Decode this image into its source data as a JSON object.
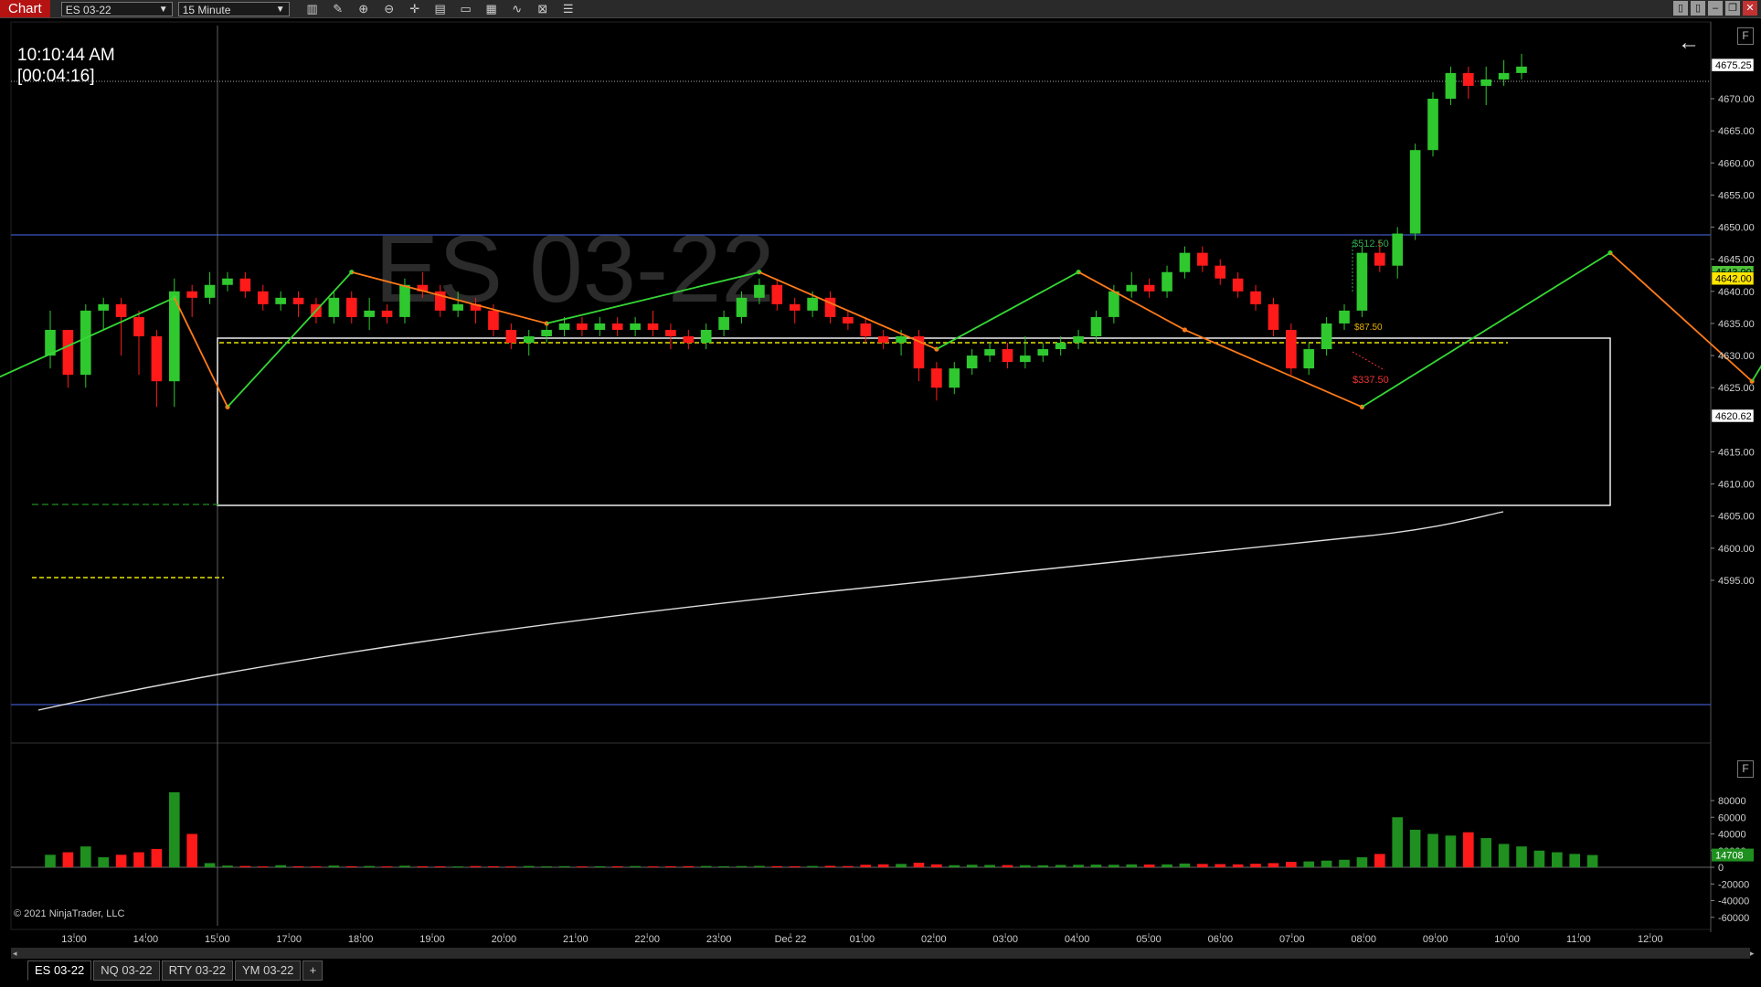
{
  "toolbar": {
    "window_label": "Chart",
    "instrument": "ES 03-22",
    "period": "15 Minute",
    "tools": [
      "bar-type-icon",
      "draw-icon",
      "zoom-in-icon",
      "zoom-out-icon",
      "crosshair-icon",
      "properties-icon",
      "templates-icon",
      "chart-trader-icon",
      "indicators-icon",
      "strategies-icon",
      "data-box-icon"
    ]
  },
  "clock": {
    "time": "10:10:44 AM",
    "bar_timer": "[00:04:16]"
  },
  "watermark": "ES 03-22",
  "price_axis": {
    "labels": [
      "4670.00",
      "4665.00",
      "4660.00",
      "4655.00",
      "4650.00",
      "4645.00",
      "4640.00",
      "4635.00",
      "4630.00",
      "4625.00",
      "4615.00",
      "4610.00",
      "4605.00",
      "4600.00",
      "4595.00"
    ],
    "markers": [
      {
        "label": "4675.25",
        "bg": "#ffffff",
        "fg": "#000000"
      },
      {
        "label": "4643.00",
        "bg": "#4fc13a",
        "fg": "#000000"
      },
      {
        "label": "4642.00",
        "bg": "#ffe500",
        "fg": "#000000"
      },
      {
        "label": "4620.62",
        "bg": "#ffffff",
        "fg": "#000000"
      }
    ]
  },
  "volume_axis": {
    "labels": [
      "80000",
      "60000",
      "40000",
      "20000",
      "0",
      "-20000",
      "-40000",
      "-60000"
    ],
    "marker": {
      "label": "14708",
      "bg": "#1f8f1f",
      "fg": "#ffffff"
    }
  },
  "time_axis": {
    "labels": [
      "13:00",
      "14:00",
      "15:00",
      "17:00",
      "18:00",
      "19:00",
      "20:00",
      "21:00",
      "22:00",
      "23:00",
      "Dec 22",
      "01:00",
      "02:00",
      "03:00",
      "04:00",
      "05:00",
      "06:00",
      "07:00",
      "08:00",
      "09:00",
      "10:00",
      "11:00",
      "12:00"
    ]
  },
  "trade_labels": {
    "profit": "$512.50",
    "target": "$87.50",
    "loss": "$337.50"
  },
  "copyright": "© 2021 NinjaTrader, LLC",
  "f_button": "F",
  "tabs": [
    {
      "label": "ES 03-22"
    },
    {
      "label": "NQ 03-22"
    },
    {
      "label": "RTY 03-22"
    },
    {
      "label": "YM 03-22"
    }
  ],
  "tab_add": "+",
  "colors": {
    "up": "#2fc82f",
    "down": "#ff1a1a",
    "zigzag_up": "#35d835",
    "zigzag_down": "#ff7a18",
    "range_box": "#ffffff",
    "hline": "#3d57c4",
    "dashed_yellow": "#e8e200",
    "vol_up": "#1f8f1f",
    "vol_down": "#ff1a1a"
  },
  "candles": [
    [
      4630,
      4637,
      4628,
      4634
    ],
    [
      4634,
      4633,
      4625,
      4627
    ],
    [
      4627,
      4638,
      4625,
      4637
    ],
    [
      4637,
      4639,
      4634,
      4638
    ],
    [
      4638,
      4639,
      4630,
      4636
    ],
    [
      4636,
      4637,
      4627,
      4633
    ],
    [
      4633,
      4634,
      4622,
      4626
    ],
    [
      4626,
      4642,
      4622,
      4640
    ],
    [
      4640,
      4641,
      4636,
      4639
    ],
    [
      4639,
      4643,
      4638,
      4641
    ],
    [
      4641,
      4643,
      4640,
      4642
    ],
    [
      4642,
      4643,
      4639,
      4640
    ],
    [
      4640,
      4641,
      4637,
      4638
    ],
    [
      4638,
      4640,
      4637,
      4639
    ],
    [
      4639,
      4640,
      4636,
      4638
    ],
    [
      4638,
      4639,
      4635,
      4636
    ],
    [
      4636,
      4640,
      4635,
      4639
    ],
    [
      4639,
      4640,
      4635,
      4636
    ],
    [
      4636,
      4639,
      4634,
      4637
    ],
    [
      4637,
      4638,
      4635,
      4636
    ],
    [
      4636,
      4642,
      4635,
      4641
    ],
    [
      4641,
      4643,
      4639,
      4640
    ],
    [
      4640,
      4641,
      4636,
      4637
    ],
    [
      4637,
      4640,
      4636,
      4638
    ],
    [
      4638,
      4639,
      4635,
      4637
    ],
    [
      4637,
      4638,
      4633,
      4634
    ],
    [
      4634,
      4635,
      4631,
      4632
    ],
    [
      4632,
      4634,
      4630,
      4633
    ],
    [
      4633,
      4635,
      4632,
      4634
    ],
    [
      4634,
      4636,
      4633,
      4635
    ],
    [
      4635,
      4636,
      4633,
      4634
    ],
    [
      4634,
      4636,
      4633,
      4635
    ],
    [
      4635,
      4636,
      4633,
      4634
    ],
    [
      4634,
      4636,
      4633,
      4635
    ],
    [
      4635,
      4637,
      4633,
      4634
    ],
    [
      4634,
      4635,
      4631,
      4633
    ],
    [
      4633,
      4634,
      4631,
      4632
    ],
    [
      4632,
      4635,
      4631,
      4634
    ],
    [
      4634,
      4637,
      4633,
      4636
    ],
    [
      4636,
      4640,
      4635,
      4639
    ],
    [
      4639,
      4642,
      4638,
      4641
    ],
    [
      4641,
      4642,
      4637,
      4638
    ],
    [
      4638,
      4639,
      4635,
      4637
    ],
    [
      4637,
      4640,
      4636,
      4639
    ],
    [
      4639,
      4640,
      4635,
      4636
    ],
    [
      4636,
      4637,
      4634,
      4635
    ],
    [
      4635,
      4636,
      4632,
      4633
    ],
    [
      4633,
      4634,
      4631,
      4632
    ],
    [
      4632,
      4634,
      4630,
      4633
    ],
    [
      4633,
      4634,
      4626,
      4628
    ],
    [
      4628,
      4629,
      4623,
      4625
    ],
    [
      4625,
      4629,
      4624,
      4628
    ],
    [
      4628,
      4631,
      4627,
      4630
    ],
    [
      4630,
      4632,
      4629,
      4631
    ],
    [
      4631,
      4632,
      4628,
      4629
    ],
    [
      4629,
      4633,
      4628,
      4630
    ],
    [
      4630,
      4632,
      4629,
      4631
    ],
    [
      4631,
      4633,
      4630,
      4632
    ],
    [
      4632,
      4634,
      4631,
      4633
    ],
    [
      4633,
      4637,
      4632,
      4636
    ],
    [
      4636,
      4641,
      4635,
      4640
    ],
    [
      4640,
      4643,
      4639,
      4641
    ],
    [
      4641,
      4642,
      4639,
      4640
    ],
    [
      4640,
      4644,
      4639,
      4643
    ],
    [
      4643,
      4647,
      4642,
      4646
    ],
    [
      4646,
      4647,
      4643,
      4644
    ],
    [
      4644,
      4645,
      4641,
      4642
    ],
    [
      4642,
      4643,
      4639,
      4640
    ],
    [
      4640,
      4641,
      4637,
      4638
    ],
    [
      4638,
      4639,
      4633,
      4634
    ],
    [
      4634,
      4635,
      4627,
      4628
    ],
    [
      4628,
      4632,
      4627,
      4631
    ],
    [
      4631,
      4636,
      4630,
      4635
    ],
    [
      4635,
      4638,
      4634,
      4637
    ],
    [
      4637,
      4647,
      4636,
      4646
    ],
    [
      4646,
      4648,
      4643,
      4644
    ],
    [
      4644,
      4650,
      4642,
      4649
    ],
    [
      4649,
      4663,
      4648,
      4662
    ],
    [
      4662,
      4671,
      4661,
      4670
    ],
    [
      4670,
      4675,
      4669,
      4674
    ],
    [
      4674,
      4675,
      4670,
      4672
    ],
    [
      4672,
      4675,
      4669,
      4673
    ],
    [
      4673,
      4676,
      4672,
      4674
    ],
    [
      4674,
      4677,
      4673,
      4675
    ]
  ],
  "volume": [
    15000,
    18000,
    25000,
    12000,
    15000,
    18000,
    22000,
    90000,
    40000,
    5000,
    2000,
    1500,
    1000,
    2500,
    1200,
    1000,
    2000,
    1200,
    1500,
    1000,
    1800,
    1200,
    1100,
    1000,
    1400,
    1200,
    1000,
    1500,
    1100,
    1300,
    1000,
    1200,
    1100,
    1400,
    1000,
    1200,
    1300,
    1500,
    1200,
    1400,
    1600,
    1300,
    1200,
    1500,
    1700,
    1400,
    3000,
    3500,
    4000,
    5500,
    3500,
    2500,
    3000,
    2800,
    2600,
    2500,
    2400,
    2800,
    3000,
    3200,
    3000,
    3500,
    3300,
    3500,
    4500,
    4000,
    3800,
    3500,
    4200,
    5000,
    6500,
    7000,
    8000,
    9000,
    12000,
    16000,
    60000,
    45000,
    40000,
    38000,
    42000,
    35000,
    28000,
    25000,
    20000,
    18000,
    16000,
    14708
  ]
}
